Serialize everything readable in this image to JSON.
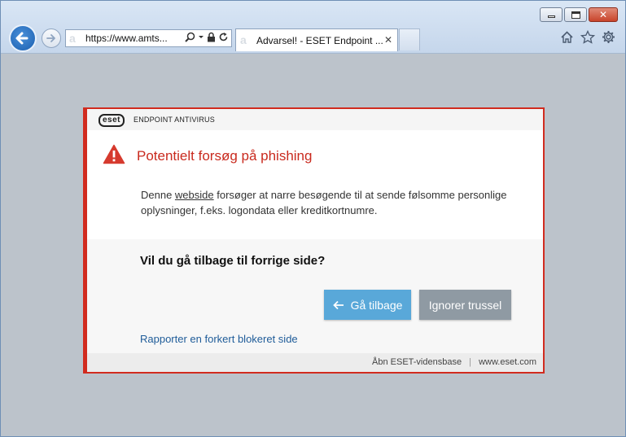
{
  "browser": {
    "address": "https://www.amts...",
    "tab_title": "Advarsel! - ESET Endpoint ...",
    "tab_close": "✕"
  },
  "eset": {
    "logo": "eset",
    "product": "ENDPOINT ANTIVIRUS",
    "warning_title": "Potentielt forsøg på phishing",
    "description_pre": "Denne ",
    "description_link": "webside",
    "description_post": " forsøger at narre besøgende til at sende følsomme personlige oplysninger, f.eks. logondata eller kreditkortnumre.",
    "question": "Vil du gå tilbage til forrige side?",
    "back_button": "Gå tilbage",
    "ignore_button": "Ignorer trussel",
    "report_link": "Rapporter en forkert blokeret side",
    "footer_kb": "Åbn ESET-vidensbase",
    "footer_sep": "|",
    "footer_site": "www.eset.com"
  },
  "colors": {
    "accent_red": "#d12b1f",
    "button_blue": "#59a8d9",
    "button_gray": "#8f9aa3",
    "link_blue": "#1f5c99"
  },
  "icons": [
    "back-arrow-icon",
    "forward-arrow-icon",
    "search-icon",
    "dropdown-icon",
    "lock-icon",
    "refresh-icon",
    "home-icon",
    "favorites-star-icon",
    "settings-gear-icon",
    "warning-triangle-icon",
    "arrow-left-icon"
  ]
}
